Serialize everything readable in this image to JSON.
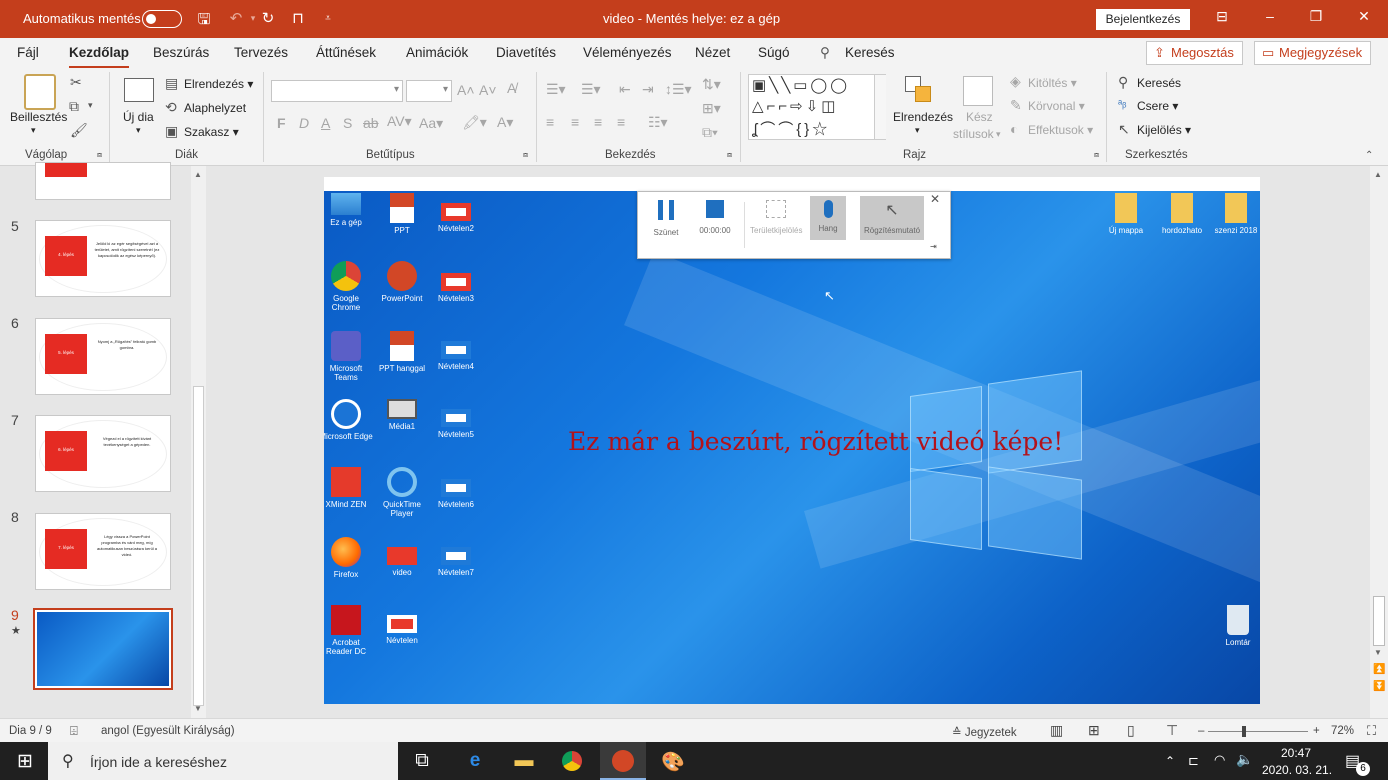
{
  "titlebar": {
    "autosave_label": "Automatikus mentés",
    "title": "video  -  Mentés helye: ez a gép",
    "signin_label": "Bejelentkezés",
    "icons": [
      "save-icon",
      "undo-icon",
      "redo-icon",
      "present-icon",
      "customize-icon"
    ]
  },
  "tabs": [
    "Fájl",
    "Kezdőlap",
    "Beszúrás",
    "Tervezés",
    "Áttűnések",
    "Animációk",
    "Diavetítés",
    "Véleményezés",
    "Nézet",
    "Súgó"
  ],
  "active_tab": "Kezdőlap",
  "search_label": "Keresés",
  "share_label": "Megosztás",
  "comments_label": "Megjegyzések",
  "ribbon": {
    "clipboard": {
      "paste": "Beillesztés",
      "group": "Vágólap"
    },
    "slides": {
      "new_slide": "Új dia",
      "layout": "Elrendezés",
      "reset": "Alaphelyzet",
      "section": "Szakasz",
      "group": "Diák"
    },
    "font": {
      "bold": "F",
      "italic": "D",
      "underline": "A",
      "shadow": "S",
      "group": "Betűtípus"
    },
    "paragraph": {
      "group": "Bekezdés"
    },
    "drawing": {
      "arrange": "Elrendezés",
      "quick_styles_1": "Kész",
      "quick_styles_2": "stílusok",
      "fill": "Kitöltés",
      "outline": "Körvonal",
      "effects": "Effektusok",
      "group": "Rajz"
    },
    "editing": {
      "find": "Keresés",
      "replace": "Csere",
      "select": "Kijelölés",
      "group": "Szerkesztés"
    }
  },
  "thumbnails": [
    {
      "num": "5",
      "title": "4. lépés",
      "text": "Jelöld ki az egér segítségével azt a területet, amit rögzíteni szeretnél (ez kapcsolódik az egész képernyő)."
    },
    {
      "num": "6",
      "title": "5. lépés",
      "text": "Nyomj a „Rögzítés” feliratú gomb gombra."
    },
    {
      "num": "7",
      "title": "6. lépés",
      "text": "Végezd el a rögzített kivánt tevékenységet a gépeden."
    },
    {
      "num": "8",
      "title": "7. lépés",
      "text": "Légy vissza a PowerPoint programba és várd meg, míg automatikusan beszúrásra kerül a videó."
    },
    {
      "num": "9",
      "star": "★"
    }
  ],
  "desktop": {
    "icons_col1": [
      "Ez a gép",
      "Google Chrome",
      "Microsoft Teams",
      "Microsoft Edge",
      "XMind ZEN",
      "Firefox",
      "Acrobat Reader DC"
    ],
    "icons_col2": [
      "PPT",
      "PowerPoint",
      "PPT hanggal",
      "Média1",
      "QuickTime Player",
      "video",
      "Névtelen"
    ],
    "icons_col3": [
      "Névtelen2",
      "Névtelen3",
      "Névtelen4",
      "Névtelen5",
      "Névtelen6",
      "Névtelen7"
    ],
    "icons_right": [
      "Új mappa",
      "hordozhato",
      "szenzi 2018"
    ],
    "recycle": "Lomtár",
    "recorder": {
      "pause": "Szünet",
      "time": "00:00:00",
      "area": "Területkijelölés",
      "audio": "Hang",
      "pointer": "Rögzítésmutató"
    },
    "caption": "Ez már a beszúrt, rögzített videó képe!"
  },
  "status": {
    "slide_info": "Dia 9 / 9",
    "language": "angol (Egyesült Királyság)",
    "notes": "Jegyzetek",
    "zoom": "72%",
    "zoom_fraction": 0.72
  },
  "taskbar": {
    "search_placeholder": "Írjon ide a kereséshez",
    "time": "20:47",
    "date": "2020. 03. 21.",
    "notifications": "6"
  }
}
